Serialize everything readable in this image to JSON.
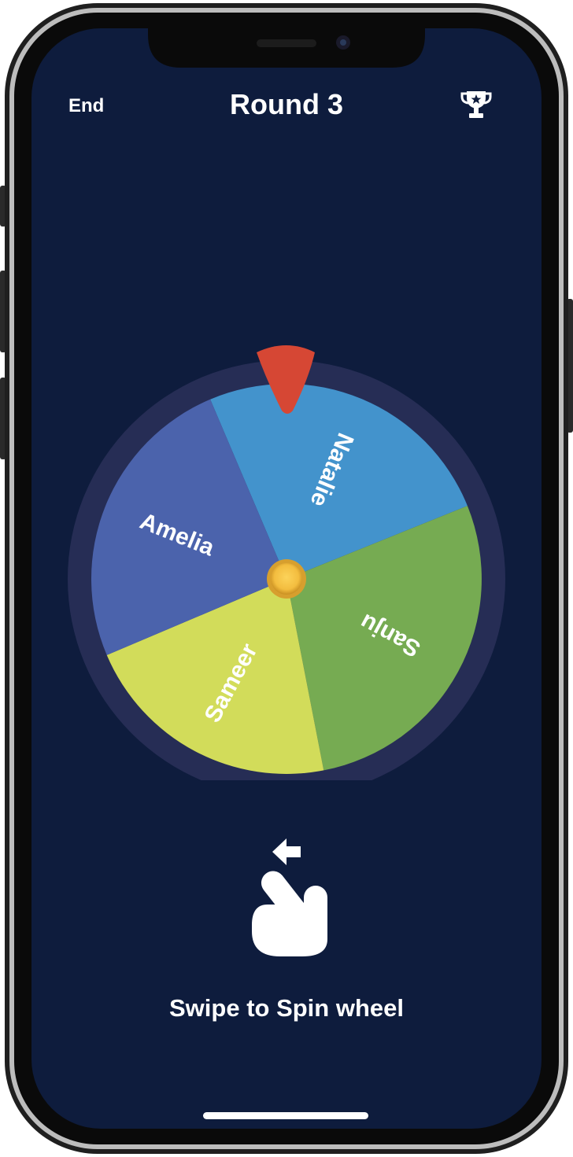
{
  "header": {
    "end_label": "End",
    "round_title": "Round 3",
    "trophy_icon": "trophy-icon"
  },
  "wheel": {
    "segments": [
      {
        "name": "Natalie",
        "color": "#4393cc"
      },
      {
        "name": "Sanju",
        "color": "#76ab52"
      },
      {
        "name": "Sameer",
        "color": "#d2dc5a"
      },
      {
        "name": "Amelia",
        "color": "#4b63ac"
      }
    ],
    "rim_color": "#262d55",
    "pointer_color": "#d64734",
    "hub_color": "#f6c248"
  },
  "hint": {
    "icon": "swipe-hand-icon",
    "text": "Swipe to Spin wheel"
  },
  "colors": {
    "background": "#0e1c3d",
    "text": "#ffffff"
  }
}
